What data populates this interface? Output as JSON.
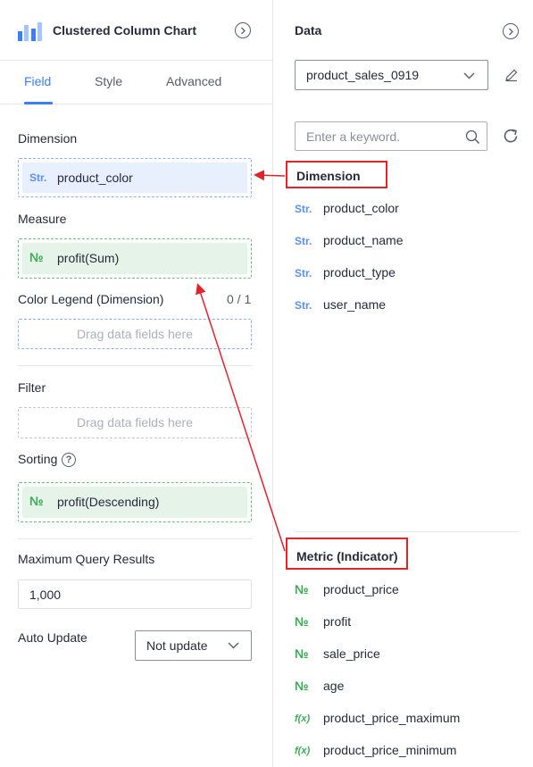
{
  "left_panel": {
    "title": "Clustered Column Chart",
    "tabs": [
      {
        "label": "Field",
        "active": true
      },
      {
        "label": "Style",
        "active": false
      },
      {
        "label": "Advanced",
        "active": false
      }
    ],
    "dimension": {
      "label": "Dimension",
      "field_type": "Str.",
      "field": "product_color"
    },
    "measure": {
      "label": "Measure",
      "field_type": "№",
      "field": "profit(Sum)"
    },
    "color_legend": {
      "label": "Color Legend (Dimension)",
      "count": "0 / 1",
      "placeholder": "Drag data fields here"
    },
    "filter": {
      "label": "Filter",
      "placeholder": "Drag data fields here"
    },
    "sorting": {
      "label": "Sorting",
      "help": "?",
      "field_type": "№",
      "field": "profit(Descending)"
    },
    "max_query": {
      "label": "Maximum Query Results",
      "value": "1,000"
    },
    "auto_update": {
      "label": "Auto Update",
      "value": "Not update"
    }
  },
  "right_panel": {
    "title": "Data",
    "dataset": "product_sales_0919",
    "search_placeholder": "Enter a keyword.",
    "dimension_section": {
      "title": "Dimension",
      "fields": [
        {
          "type": "Str.",
          "name": "product_color"
        },
        {
          "type": "Str.",
          "name": "product_name"
        },
        {
          "type": "Str.",
          "name": "product_type"
        },
        {
          "type": "Str.",
          "name": "user_name"
        }
      ]
    },
    "metric_section": {
      "title": "Metric (Indicator)",
      "fields": [
        {
          "type": "№",
          "name": "product_price"
        },
        {
          "type": "№",
          "name": "profit"
        },
        {
          "type": "№",
          "name": "sale_price"
        },
        {
          "type": "№",
          "name": "age"
        },
        {
          "type": "f(x)",
          "name": "product_price_maximum"
        },
        {
          "type": "f(x)",
          "name": "product_price_minimum"
        }
      ]
    }
  },
  "colors": {
    "accent": "#3a7ff5",
    "annotation": "#e0242b",
    "number": "#3daa57",
    "string": "#5b8ff9"
  },
  "icons": [
    "chart-logo-icon",
    "collapse-icon",
    "chevron-down-icon",
    "edit-icon",
    "search-icon",
    "refresh-icon",
    "help-icon"
  ]
}
